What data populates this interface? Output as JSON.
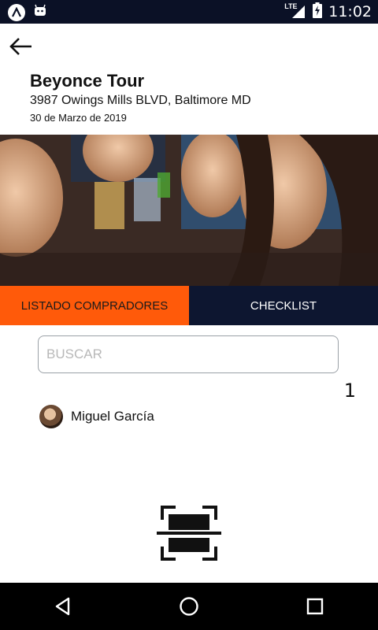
{
  "status_bar": {
    "time": "11:02",
    "network": "LTE",
    "icons": [
      "app-logo-icon",
      "android-robot-icon",
      "signal-icon",
      "battery-charging-icon"
    ]
  },
  "event": {
    "title": "Beyonce Tour",
    "address": "3987 Owings Mills BLVD, Baltimore MD",
    "date": "30 de Marzo de 2019"
  },
  "tabs": [
    {
      "label": "LISTADO COMPRADORES",
      "active": true
    },
    {
      "label": "CHECKLIST",
      "active": false
    }
  ],
  "search": {
    "placeholder": "BUSCAR",
    "value": ""
  },
  "buyers": {
    "count": "1",
    "items": [
      {
        "name": "Miguel García"
      }
    ]
  },
  "colors": {
    "status_bar": "#0b1126",
    "tab_active": "#ff5a0a",
    "tab_inactive": "#0d1630",
    "nav_bar": "#000000"
  },
  "nav_icons": [
    "back-triangle-icon",
    "home-circle-icon",
    "recents-square-icon"
  ]
}
